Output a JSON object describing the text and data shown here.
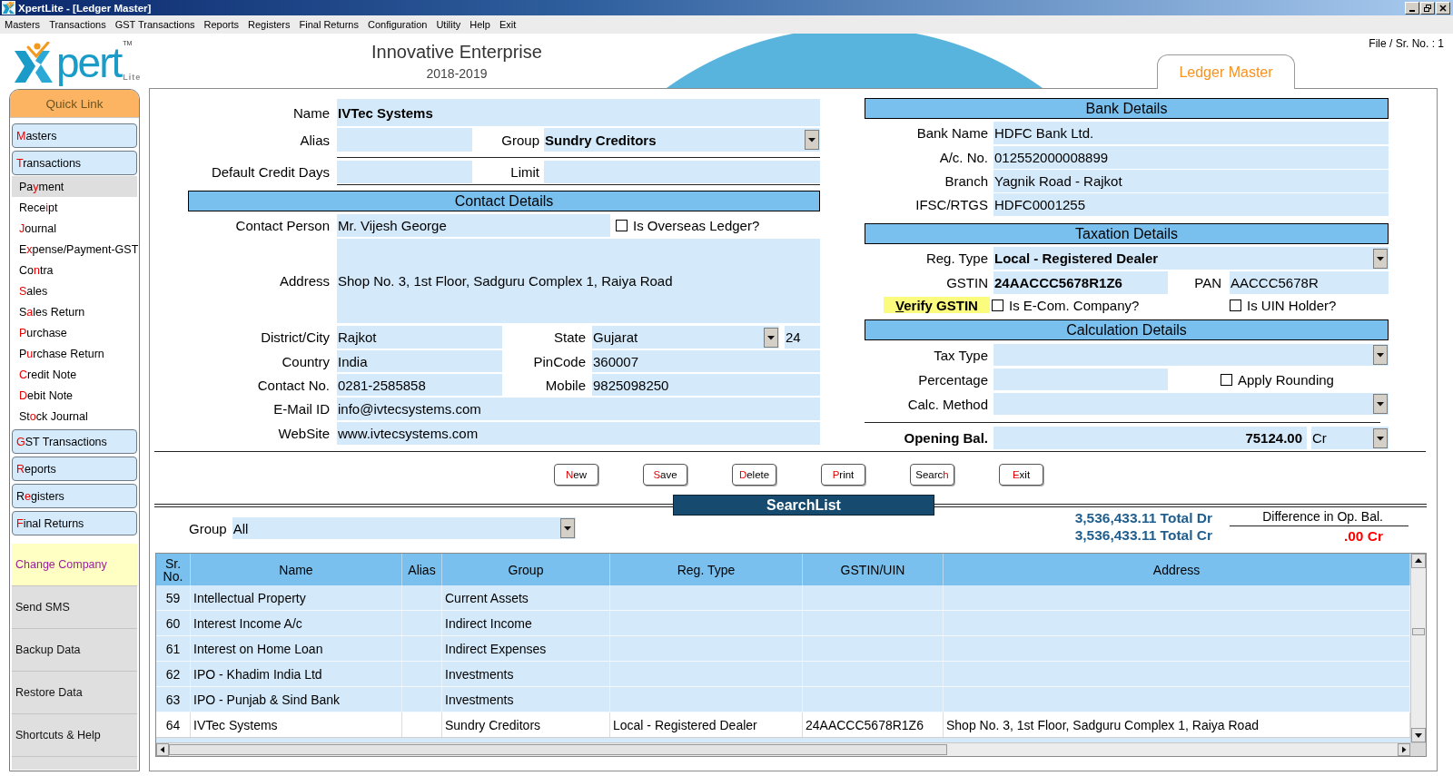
{
  "window": {
    "title": "XpertLite - [Ledger Master]"
  },
  "menu_bar": [
    "Masters",
    "Transactions",
    "GST Transactions",
    "Reports",
    "Registers",
    "Final Returns",
    "Configuration",
    "Utility",
    "Help",
    "Exit"
  ],
  "logo": {
    "wordmark": "pert",
    "trademark": "TM",
    "edition": "Lite"
  },
  "company": {
    "name": "Innovative Enterprise",
    "year": "2018-2019"
  },
  "file_sr_no": "File / Sr. No. : 1",
  "form_tab": "Ledger Master",
  "quick_link": {
    "title": "Quick Link",
    "groups": [
      {
        "label": {
          "key": "M",
          "post": "asters"
        }
      },
      {
        "label": {
          "key": "T",
          "post": "ransactions"
        },
        "children": [
          {
            "label": {
              "pre": "Pa",
              "key": "y",
              "post": "ment"
            },
            "selected": true
          },
          {
            "label": {
              "pre": "Rece",
              "key": "i",
              "post": "pt"
            },
            "selected": false
          },
          {
            "label": {
              "key": "J",
              "post": "ournal"
            },
            "selected": false
          },
          {
            "label": {
              "pre": "E",
              "key": "x",
              "post": "pense/Payment-GST"
            },
            "selected": false
          },
          {
            "label": {
              "pre": "Co",
              "key": "n",
              "post": "tra"
            },
            "selected": false
          },
          {
            "label": {
              "key": "S",
              "post": "ales"
            },
            "selected": false
          },
          {
            "label": {
              "pre": "S",
              "key": "a",
              "post": "les Return"
            },
            "selected": false
          },
          {
            "label": {
              "key": "P",
              "post": "urchase"
            },
            "selected": false
          },
          {
            "label": {
              "pre": "P",
              "key": "u",
              "post": "rchase Return"
            },
            "selected": false
          },
          {
            "label": {
              "key": "C",
              "post": "redit Note"
            },
            "selected": false
          },
          {
            "label": {
              "key": "D",
              "post": "ebit Note"
            },
            "selected": false
          },
          {
            "label": {
              "pre": "St",
              "key": "o",
              "post": "ck Journal"
            },
            "selected": false
          }
        ]
      },
      {
        "label": {
          "key": "G",
          "post": "ST Transactions"
        }
      },
      {
        "label": {
          "key": "R",
          "post": "eports"
        }
      },
      {
        "label": {
          "pre": "R",
          "key": "e",
          "post": "gisters"
        }
      },
      {
        "label": {
          "key": "F",
          "post": "inal Returns"
        }
      }
    ],
    "actions": [
      {
        "label": "Change Company",
        "selected": true
      },
      {
        "label": "Send SMS",
        "selected": false
      },
      {
        "label": "Backup Data",
        "selected": false
      },
      {
        "label": "Restore Data",
        "selected": false
      },
      {
        "label": "Shortcuts & Help",
        "selected": false
      }
    ]
  },
  "general": {
    "name": {
      "label": "Name",
      "kind": "text",
      "value": "IVTec Systems"
    },
    "alias": {
      "label": "Alias",
      "kind": "text"
    },
    "group": {
      "label": "Group",
      "kind": "dropdown",
      "value": "Sundry Creditors"
    },
    "default_credit_days": {
      "label": "Default Credit Days",
      "kind": "text"
    },
    "limit": {
      "label": "Limit",
      "kind": "text"
    }
  },
  "contact_details": {
    "title": "Contact Details",
    "contact_person": {
      "label": "Contact Person",
      "kind": "text",
      "value": "Mr. Vijesh George"
    },
    "is_overseas_ledger": {
      "label": "Is Overseas Ledger?",
      "checked": false
    },
    "address": {
      "label": "Address",
      "kind": "text",
      "value": "Shop No. 3, 1st Floor, Sadguru Complex 1, Raiya Road"
    },
    "district_city": {
      "label": "District/City",
      "kind": "text",
      "value": "Rajkot"
    },
    "state": {
      "label": "State",
      "kind": "dropdown",
      "value": "Gujarat"
    },
    "state_code": {
      "kind": "text",
      "value": "24"
    },
    "country": {
      "label": "Country",
      "kind": "text",
      "value": "India"
    },
    "pincode": {
      "label": "PinCode",
      "kind": "text",
      "value": "360007"
    },
    "contact_no": {
      "label": "Contact No.",
      "kind": "text",
      "value": "0281-2585858"
    },
    "mobile": {
      "label": "Mobile",
      "kind": "text",
      "value": "9825098250"
    },
    "email": {
      "label": "E-Mail ID",
      "kind": "text",
      "value": "info@ivtecsystems.com"
    },
    "website": {
      "label": "WebSite",
      "kind": "text",
      "value": "www.ivtecsystems.com"
    }
  },
  "bank_details": {
    "title": "Bank Details",
    "fields": [
      {
        "label": "Bank Name",
        "kind": "text",
        "value": "HDFC Bank Ltd."
      },
      {
        "label": "A/c. No.",
        "kind": "text",
        "value": "012552000008899"
      },
      {
        "label": "Branch",
        "kind": "text",
        "value": "Yagnik Road - Rajkot"
      },
      {
        "label": "IFSC/RTGS",
        "kind": "text",
        "value": "HDFC0001255"
      }
    ]
  },
  "taxation_details": {
    "title": "Taxation Details",
    "reg_type": {
      "label": "Reg. Type",
      "kind": "dropdown",
      "value": "Local - Registered Dealer"
    },
    "gstin": {
      "label": "GSTIN",
      "kind": "text",
      "value": "24AACCC5678R1Z6"
    },
    "pan": {
      "label": "PAN",
      "kind": "text",
      "value": "AACCC5678R"
    },
    "verify_gstin": {
      "key": "V",
      "post": "erify GSTIN"
    },
    "is_ecom_company": {
      "label": "Is E-Com. Company?",
      "checked": false
    },
    "is_uin_holder": {
      "label": "Is UIN Holder?",
      "checked": false
    }
  },
  "calculation_details": {
    "title": "Calculation Details",
    "tax_type": {
      "label": "Tax Type",
      "kind": "dropdown"
    },
    "percentage": {
      "label": "Percentage",
      "kind": "text"
    },
    "apply_rounding": {
      "label": "Apply Rounding",
      "checked": false
    },
    "calc_method": {
      "label": "Calc. Method",
      "kind": "dropdown"
    }
  },
  "opening_balance": {
    "label": "Opening Bal.",
    "amount": {
      "kind": "text",
      "value": "75124.00"
    },
    "side": {
      "kind": "dropdown",
      "value": "Cr"
    }
  },
  "actions": [
    {
      "key": "N",
      "post": "ew"
    },
    {
      "key": "S",
      "post": "ave"
    },
    {
      "key": "D",
      "post": "elete"
    },
    {
      "key": "P",
      "post": "rint"
    },
    {
      "pre": "Searc",
      "key": "h"
    },
    {
      "key": "E",
      "post": "xit"
    }
  ],
  "search_list": {
    "title": "SearchList",
    "group_filter": {
      "label": "Group",
      "kind": "dropdown",
      "value": "All"
    },
    "totals": [
      {
        "amount": "3,536,433.11",
        "label": "Total Dr"
      },
      {
        "amount": "3,536,433.11",
        "label": "Total Cr"
      }
    ],
    "difference": {
      "label": "Difference in Op. Bal.",
      "value": ".00 Cr"
    },
    "table": {
      "columns": [
        "Sr. No.",
        "Name",
        "Alias",
        "Group",
        "Reg. Type",
        "GSTIN/UIN",
        "Address"
      ],
      "rows": [
        {
          "sr_no": "59",
          "name": "Intellectual Property",
          "group": "Current Assets",
          "selected": false
        },
        {
          "sr_no": "60",
          "name": "Interest Income A/c",
          "group": "Indirect Income",
          "selected": false
        },
        {
          "sr_no": "61",
          "name": "Interest on Home Loan",
          "group": "Indirect Expenses",
          "selected": false
        },
        {
          "sr_no": "62",
          "name": "IPO - Khadim India Ltd",
          "group": "Investments",
          "selected": false
        },
        {
          "sr_no": "63",
          "name": "IPO - Punjab & Sind Bank",
          "group": "Investments",
          "selected": false
        },
        {
          "sr_no": "64",
          "name": "IVTec Systems",
          "group": "Sundry Creditors",
          "reg_type": "Local - Registered Dealer",
          "gstin_uin": "24AACCC5678R1Z6",
          "address": "Shop No. 3, 1st Floor, Sadguru Complex 1, Raiya Road",
          "selected": true
        }
      ]
    }
  }
}
